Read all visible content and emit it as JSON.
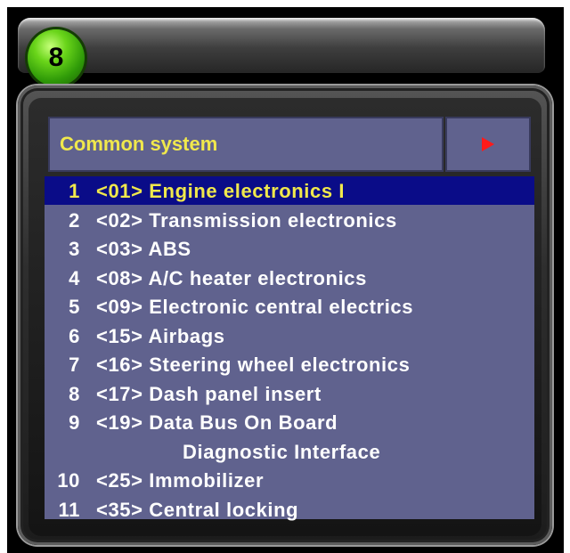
{
  "page_badge": "8",
  "header": {
    "title": "Common system"
  },
  "items": [
    {
      "num": "1",
      "label": "<01> Engine electronics I",
      "selected": true
    },
    {
      "num": "2",
      "label": "<02> Transmission electronics"
    },
    {
      "num": "3",
      "label": "<03> ABS"
    },
    {
      "num": "4",
      "label": "<08> A/C heater electronics"
    },
    {
      "num": "5",
      "label": "<09> Electronic central electrics"
    },
    {
      "num": "6",
      "label": "<15> Airbags"
    },
    {
      "num": "7",
      "label": "<16> Steering wheel electronics"
    },
    {
      "num": "8",
      "label": "<17> Dash panel insert"
    },
    {
      "num": "9",
      "label": "<19> Data Bus On Board",
      "continuation": "Diagnostic Interface"
    },
    {
      "num": "10",
      "label": "<25> Immobilizer"
    },
    {
      "num": "11",
      "label": "<35> Central locking"
    }
  ],
  "colors": {
    "panel": "#60628e",
    "selected_bg": "#0a0c88",
    "accent_text": "#f0e84c",
    "arrow": "#ff1a1a",
    "badge": "#4fb814"
  },
  "icons": {
    "next": "red-triangle-right-icon"
  }
}
